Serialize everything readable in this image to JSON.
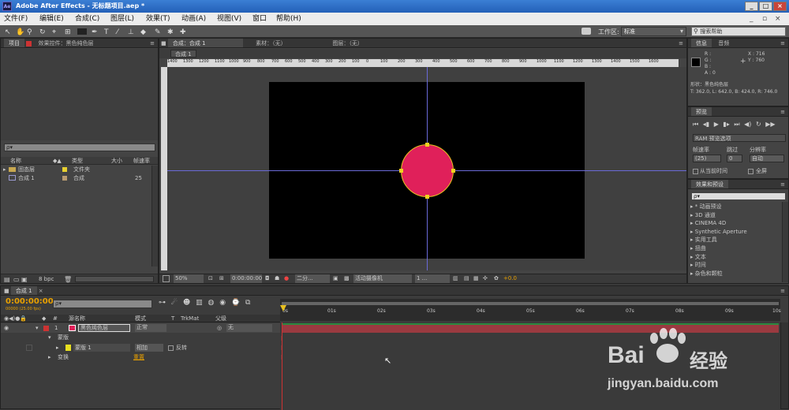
{
  "titlebar": {
    "icon": "Ae",
    "title": "Adobe After Effects - 无标题项目.aep *",
    "buttons": [
      "_",
      "□",
      "×"
    ]
  },
  "menu": [
    "文件(F)",
    "编辑(E)",
    "合成(C)",
    "图层(L)",
    "效果(T)",
    "动画(A)",
    "视图(V)",
    "窗口",
    "帮助(H)"
  ],
  "toolbar": {
    "workspace_label": "工作区:",
    "workspace_value": "标准",
    "search_placeholder": "搜索帮助"
  },
  "project_panel": {
    "tab_project": "项目",
    "tab_effects": "效果控件：黑色纯色层",
    "search_placeholder": "ρ▾",
    "columns": [
      "名称",
      "类型",
      "大小",
      "帧速率"
    ],
    "items": [
      {
        "name": "固态层",
        "type": "文件夹",
        "size": "",
        "fps": ""
      },
      {
        "name": "合成 1",
        "type": "合成",
        "size": "",
        "fps": "25"
      }
    ],
    "bpc": "8 bpc"
  },
  "comp_panel": {
    "tabs": [
      "合成：合成 1",
      "素材：（无）",
      "图层：（无）"
    ],
    "subtab": "合成 1",
    "ruler": [
      "1400",
      "1300",
      "1200",
      "1100",
      "1000",
      "900",
      "800",
      "700",
      "600",
      "500",
      "400",
      "300",
      "200",
      "100",
      "0",
      "100",
      "200",
      "300",
      "400",
      "500",
      "600",
      "700",
      "800",
      "900",
      "1000",
      "1100",
      "1200",
      "1300",
      "1400",
      "1500",
      "1600"
    ],
    "zoom": "50%",
    "timecode": "0:00:00:00",
    "resolution": "二分...",
    "camera": "活动摄像机",
    "views": "1 ...",
    "exposure": "+0.0"
  },
  "info_panel": {
    "tab_info": "信息",
    "tab_audio": "音频",
    "r": "R :",
    "g": "G :",
    "b": "B :",
    "a": "A : 0",
    "x": "X : 716",
    "y": "Y : 760",
    "shape_line1": "形状：黑色纯色层",
    "shape_line2": "T: 362.0, L: 642.0, B: 424.0, R: 746.0"
  },
  "preview_panel": {
    "tab": "预览",
    "ram_option": "RAM 预览选项",
    "fps_label": "帧速率",
    "skip_label": "跳过",
    "res_label": "分辨率",
    "fps_value": "(25)",
    "skip_value": "0",
    "res_value": "自动",
    "from_current": "从当前时间",
    "fullscreen": "全屏"
  },
  "effects_panel": {
    "tab": "效果和预设",
    "search_placeholder": "ρ▾",
    "items": [
      "* 动画预设",
      "3D 通道",
      "CINEMA 4D",
      "Synthetic Aperture",
      "实用工具",
      "扭曲",
      "文本",
      "时间",
      "杂色和颗粒"
    ]
  },
  "timeline": {
    "tab": "合成 1",
    "timecode": "0:00:00:00",
    "fps_note": "00000 (25.00 fps)",
    "search_placeholder": "ρ▾",
    "columns": {
      "source": "源名称",
      "mode": "模式",
      "t": "T",
      "trkmat": "TrkMat",
      "parent": "父级"
    },
    "layer": {
      "num": "1",
      "name": "黑色纯色层",
      "mode": "正常",
      "parent": "无"
    },
    "mask_group": "蒙版",
    "mask": {
      "name": "蒙版 1",
      "mode": "相加",
      "invert": "反转"
    },
    "transform": "变换",
    "transform_value": "重置",
    "ticks": [
      "0s",
      "01s",
      "02s",
      "03s",
      "04s",
      "05s",
      "06s",
      "07s",
      "08s",
      "09s",
      "10s"
    ]
  },
  "watermark": {
    "brand": "Bai",
    "brand_mid": "经验",
    "url": "jingyan.baidu.com"
  },
  "colors": {
    "circle": "#e0205a",
    "circle_outline": "#e8c020",
    "label_red": "#cc3333",
    "timecode": "#e8a000",
    "guide": "#6a6ad8"
  }
}
